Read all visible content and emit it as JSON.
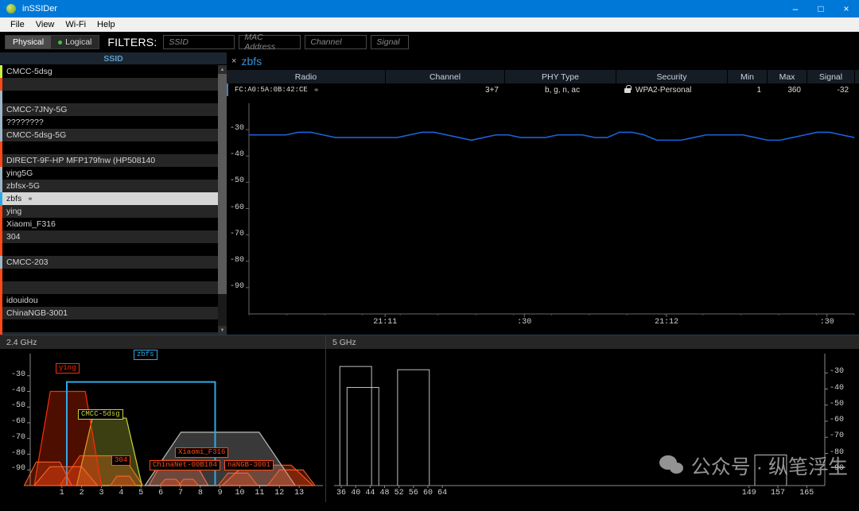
{
  "window": {
    "title": "inSSIDer",
    "minimize": "–",
    "maximize": "□",
    "close": "×"
  },
  "menu": {
    "items": [
      "File",
      "View",
      "Wi-Fi",
      "Help"
    ]
  },
  "toolbar": {
    "physical_label": "Physical",
    "logical_label": "Logical",
    "filters_label": "FILTERS:",
    "filters": [
      {
        "name": "ssid",
        "placeholder": "SSID",
        "value": ""
      },
      {
        "name": "mac",
        "placeholder": "MAC Address",
        "value": ""
      },
      {
        "name": "channel",
        "placeholder": "Channel",
        "value": ""
      },
      {
        "name": "signal",
        "placeholder": "Signal",
        "value": ""
      }
    ]
  },
  "ssid_panel": {
    "header": "SSID",
    "link_icon": "⚭",
    "rows": [
      {
        "name": "CMCC-5dsg",
        "color": "#c8f23c",
        "selected": false
      },
      {
        "name": "",
        "color": "#ff4a17",
        "selected": false
      },
      {
        "name": "",
        "color": "#9fb6c8",
        "selected": false
      },
      {
        "name": "CMCC-7JNy-5G",
        "color": "#9fb6c8",
        "selected": false
      },
      {
        "name": "????????",
        "color": "#9fb6c8",
        "selected": false
      },
      {
        "name": "CMCC-5dsg-5G",
        "color": "#9fb6c8",
        "selected": false
      },
      {
        "name": "",
        "color": "#ff4a17",
        "selected": false
      },
      {
        "name": "DIRECT-9F-HP MFP179fnw (HP508140",
        "color": "#ff4a17",
        "selected": false
      },
      {
        "name": "ying5G",
        "color": "#9fb6c8",
        "selected": false
      },
      {
        "name": "zbfsx-5G",
        "color": "#9fb6c8",
        "selected": false
      },
      {
        "name": "zbfs",
        "color": "#2fa8e8",
        "selected": true,
        "linked": true
      },
      {
        "name": "ying",
        "color": "#ff4a17",
        "selected": false
      },
      {
        "name": "Xiaomi_F316",
        "color": "#ff4a17",
        "selected": false
      },
      {
        "name": "304",
        "color": "#ff4a17",
        "selected": false
      },
      {
        "name": "",
        "color": "#ff4a17",
        "selected": false
      },
      {
        "name": "CMCC-203",
        "color": "#9fb6c8",
        "selected": false
      },
      {
        "name": "",
        "color": "#ff4a17",
        "selected": false
      },
      {
        "name": "",
        "color": "#ff4a17",
        "selected": false
      },
      {
        "name": "idouidou",
        "color": "#ff4a17",
        "selected": false
      },
      {
        "name": "ChinaNGB-3001",
        "color": "#ff4a17",
        "selected": false
      },
      {
        "name": "",
        "color": "#ff4a17",
        "selected": false
      },
      {
        "name": "ChinaNet-00B184",
        "color": "#ff4a17",
        "selected": false
      }
    ],
    "scroll_up": "▲",
    "scroll_down": "▼"
  },
  "detail": {
    "close_icon": "×",
    "network_name": "zbfs",
    "columns": [
      "Radio",
      "Channel",
      "PHY Type",
      "Security",
      "Min",
      "Max",
      "Signal"
    ],
    "rows": [
      {
        "radio": "FC:A0:5A:0B:42:CE",
        "channel": "3+7",
        "phy_type": "b, g, n, ac",
        "security": "WPA2-Personal",
        "min": "1",
        "max": "360",
        "signal": "-32"
      }
    ]
  },
  "chart_data": [
    {
      "id": "signal-over-time",
      "type": "line",
      "title": "",
      "xlabel": "",
      "ylabel": "",
      "ylim": [
        -100,
        -20
      ],
      "yticks": [
        -30,
        -40,
        -50,
        -60,
        -70,
        -80,
        -90
      ],
      "xticks": [
        "21:11",
        ":30",
        "21:12",
        ":30"
      ],
      "grid": false,
      "series": [
        {
          "name": "zbfs",
          "color": "#1a63d8",
          "values": [
            -32,
            -32,
            -32,
            -32,
            -31,
            -31,
            -32,
            -33,
            -33,
            -33,
            -33,
            -33,
            -33,
            -32,
            -31,
            -31,
            -32,
            -33,
            -34,
            -33,
            -32,
            -32,
            -33,
            -33,
            -33,
            -32,
            -32,
            -32,
            -33,
            -33,
            -31,
            -31,
            -32,
            -34,
            -34,
            -34,
            -33,
            -32,
            -32,
            -32,
            -32,
            -33,
            -34,
            -34,
            -33,
            -32,
            -31,
            -31,
            -32,
            -33
          ]
        }
      ]
    },
    {
      "id": "band-24ghz",
      "type": "area",
      "title": "2.4 GHz",
      "xlabel": "",
      "ylabel": "",
      "ylim": [
        -100,
        -20
      ],
      "yticks": [
        -30,
        -40,
        -50,
        -60,
        -70,
        -80,
        -90
      ],
      "xticks": [
        1,
        2,
        3,
        4,
        5,
        6,
        7,
        8,
        9,
        10,
        11,
        12,
        13
      ],
      "networks": [
        {
          "label": "zbfs",
          "color": "#2fa8e8",
          "center": 5.0,
          "peak": -34,
          "width": 7.5,
          "labeled": true
        },
        {
          "label": "ying",
          "color": "#ff2d00",
          "center": 1.3,
          "peak": -40,
          "width": 3.4,
          "labeled": true
        },
        {
          "label": "CMCC-5dsg",
          "color": "#c8d23c",
          "center": 3.4,
          "peak": -57,
          "width": 3.3,
          "labeled": true
        },
        {
          "label": "304",
          "color": "#ff4a17",
          "center": 3.0,
          "peak": -81,
          "width": 4.2,
          "labeled": true
        },
        {
          "label": "Xiaomi_F316",
          "color": "#bdbdbd",
          "center": 9.0,
          "peak": -66,
          "width": 7.6,
          "labeled": true
        },
        {
          "label": "ChinaNet-00B184",
          "color": "#ff4a17",
          "center": 6.9,
          "peak": -84,
          "width": 3.0,
          "labeled": true
        },
        {
          "label": "naNGB-3001",
          "color": "#ff4a17",
          "center": 11.4,
          "peak": -87,
          "width": 4.6,
          "labeled": true
        }
      ]
    },
    {
      "id": "band-5ghz",
      "type": "area",
      "title": "5 GHz",
      "xlabel": "",
      "ylabel": "",
      "ylim": [
        -100,
        -20
      ],
      "yticks": [
        -30,
        -40,
        -50,
        -60,
        -70,
        -80,
        -90
      ],
      "xticks": [
        36,
        40,
        44,
        48,
        52,
        56,
        60,
        64,
        149,
        157,
        165
      ],
      "networks": [
        {
          "label": "",
          "color": "#bdbdbd",
          "channel": 40,
          "peak": -26
        },
        {
          "label": "",
          "color": "#bdbdbd",
          "channel": 42,
          "peak": -39
        },
        {
          "label": "",
          "color": "#bdbdbd",
          "channel": 56,
          "peak": -28
        },
        {
          "label": "",
          "color": "#bdbdbd",
          "channel": 155,
          "peak": -81
        }
      ]
    }
  ],
  "watermark": {
    "text": "公众号 · 纵笔浮生"
  }
}
